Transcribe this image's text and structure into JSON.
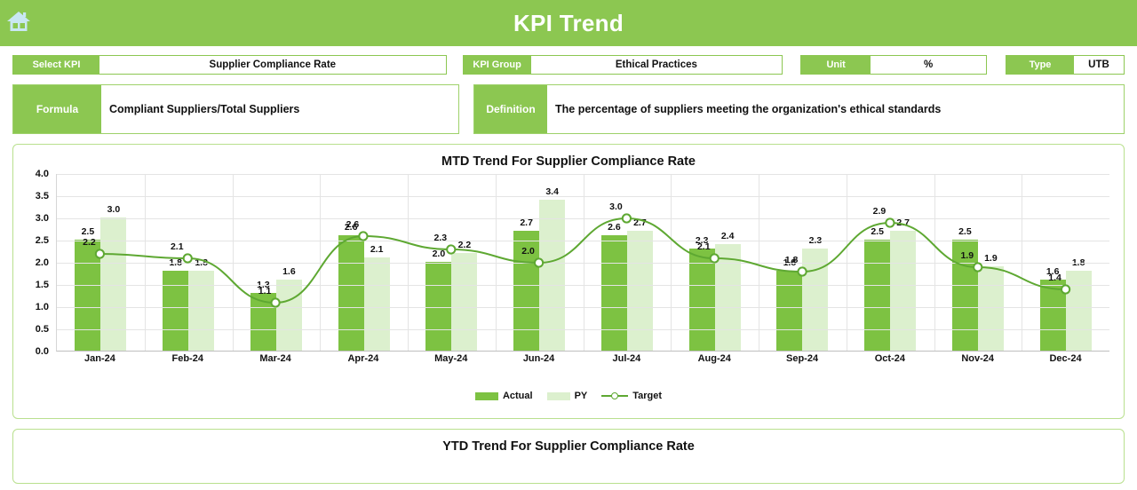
{
  "header": {
    "title": "KPI Trend",
    "home_icon": "home-icon",
    "bar_color": "#8CC751"
  },
  "filters": [
    {
      "label": "Select KPI",
      "value": "Supplier Compliance Rate"
    },
    {
      "label": "KPI Group",
      "value": "Ethical Practices"
    },
    {
      "label": "Unit",
      "value": "%"
    },
    {
      "label": "Type",
      "value": "UTB"
    }
  ],
  "meta": [
    {
      "label": "Formula",
      "value": "Compliant Suppliers/Total Suppliers"
    },
    {
      "label": "Definition",
      "value": "The percentage of suppliers meeting the organization's ethical standards"
    }
  ],
  "ytd_panel": {
    "title": "YTD Trend For Supplier Compliance Rate"
  },
  "chart_data": {
    "type": "bar",
    "title": "MTD Trend For Supplier Compliance Rate",
    "xlabel": "",
    "ylabel": "",
    "ylim": [
      0,
      4
    ],
    "yticks": [
      "0.0",
      "0.5",
      "1.0",
      "1.5",
      "2.0",
      "2.5",
      "3.0",
      "3.5",
      "4.0"
    ],
    "grid": true,
    "legend_position": "bottom",
    "categories": [
      "Jan-24",
      "Feb-24",
      "Mar-24",
      "Apr-24",
      "May-24",
      "Jun-24",
      "Jul-24",
      "Aug-24",
      "Sep-24",
      "Oct-24",
      "Nov-24",
      "Dec-24"
    ],
    "series": [
      {
        "name": "Actual",
        "type": "bar",
        "color": "#7DC242",
        "values": [
          2.5,
          1.8,
          1.3,
          2.6,
          2.0,
          2.7,
          2.6,
          2.3,
          1.8,
          2.5,
          2.5,
          1.6
        ]
      },
      {
        "name": "PY",
        "type": "bar",
        "color": "#DCF0CE",
        "values": [
          3.0,
          1.8,
          1.6,
          2.1,
          2.2,
          3.4,
          2.7,
          2.4,
          2.3,
          2.7,
          1.9,
          1.8
        ]
      },
      {
        "name": "Target",
        "type": "line",
        "color": "#5EA832",
        "values": [
          2.2,
          2.1,
          1.1,
          2.6,
          2.3,
          2.0,
          3.0,
          2.1,
          1.8,
          2.9,
          1.9,
          1.4
        ]
      }
    ]
  }
}
